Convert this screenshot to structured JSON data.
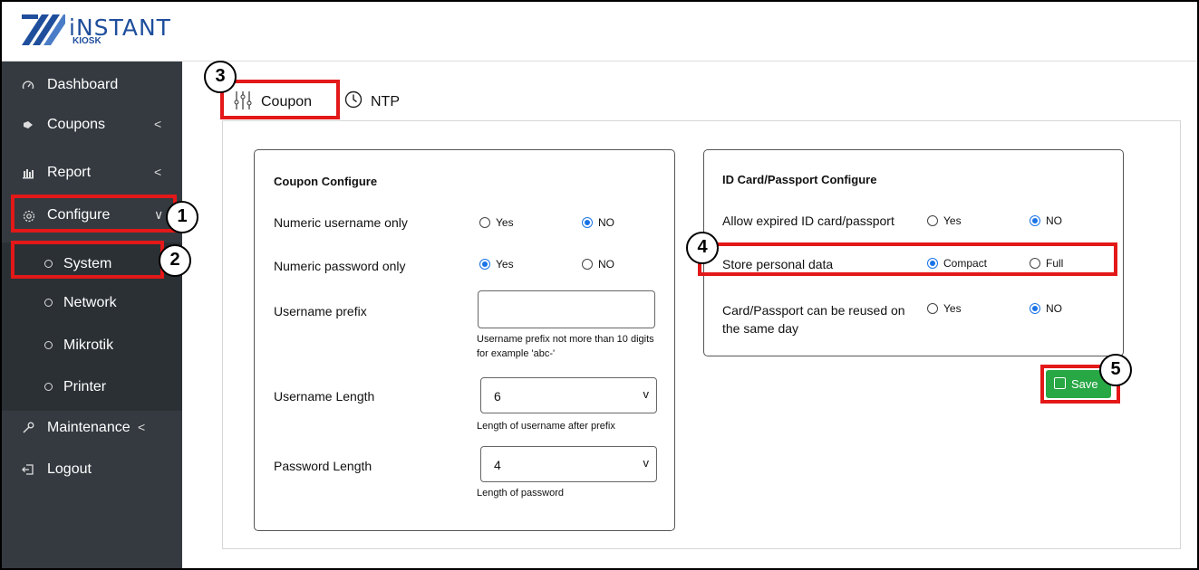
{
  "brand": {
    "title": "iNSTANT",
    "subtitle": "KIOSK",
    "color": "#1f4e9c"
  },
  "sidebar": {
    "items": [
      {
        "label": "Dashboard",
        "icon": "gauge-icon"
      },
      {
        "label": "Coupons",
        "icon": "tag-icon",
        "chevron": "<"
      },
      {
        "label": "Report",
        "icon": "bar-chart-icon",
        "chevron": "<"
      },
      {
        "label": "Configure",
        "icon": "gear-icon",
        "chevron": "∨"
      },
      {
        "label": "System",
        "icon": "circle-icon"
      },
      {
        "label": "Network",
        "icon": "circle-icon"
      },
      {
        "label": "Mikrotik",
        "icon": "circle-icon"
      },
      {
        "label": "Printer",
        "icon": "circle-icon"
      },
      {
        "label": "Maintenance",
        "icon": "wrench-icon",
        "chevron": "<"
      },
      {
        "label": "Logout",
        "icon": "logout-icon"
      }
    ]
  },
  "tabs": [
    {
      "label": "Coupon",
      "icon": "sliders-icon",
      "active": true
    },
    {
      "label": "NTP",
      "icon": "clock-icon",
      "active": false
    }
  ],
  "coupon": {
    "title": "Coupon Configure",
    "numeric_username": {
      "label": "Numeric username only",
      "yes": "Yes",
      "no": "NO",
      "selected": "NO"
    },
    "numeric_password": {
      "label": "Numeric password only",
      "yes": "Yes",
      "no": "NO",
      "selected": "Yes"
    },
    "username_prefix": {
      "label": "Username prefix",
      "value": "",
      "help": "Username prefix not more than 10 digits for example 'abc-'"
    },
    "username_length": {
      "label": "Username Length",
      "value": "6",
      "help": "Length of username after prefix"
    },
    "password_length": {
      "label": "Password Length",
      "value": "4",
      "help": "Length of password"
    }
  },
  "id_card": {
    "title": "ID Card/Passport Configure",
    "allow_expired": {
      "label": "Allow expired ID card/passport",
      "yes": "Yes",
      "no": "NO",
      "selected": "NO"
    },
    "store_personal": {
      "label": "Store personal data",
      "opt1": "Compact",
      "opt2": "Full",
      "selected": "Compact"
    },
    "reuse_same_day": {
      "label": "Card/Passport can be reused on the same day",
      "yes": "Yes",
      "no": "NO",
      "selected": "NO"
    }
  },
  "save_button": {
    "label": "Save",
    "icon": "floppy-icon",
    "color": "#28a745"
  },
  "markers": [
    "1",
    "2",
    "3",
    "4",
    "5"
  ],
  "colors": {
    "sidebar": "#343a40",
    "annotation": "#e31818",
    "radio_selected": "#1a73e8"
  }
}
